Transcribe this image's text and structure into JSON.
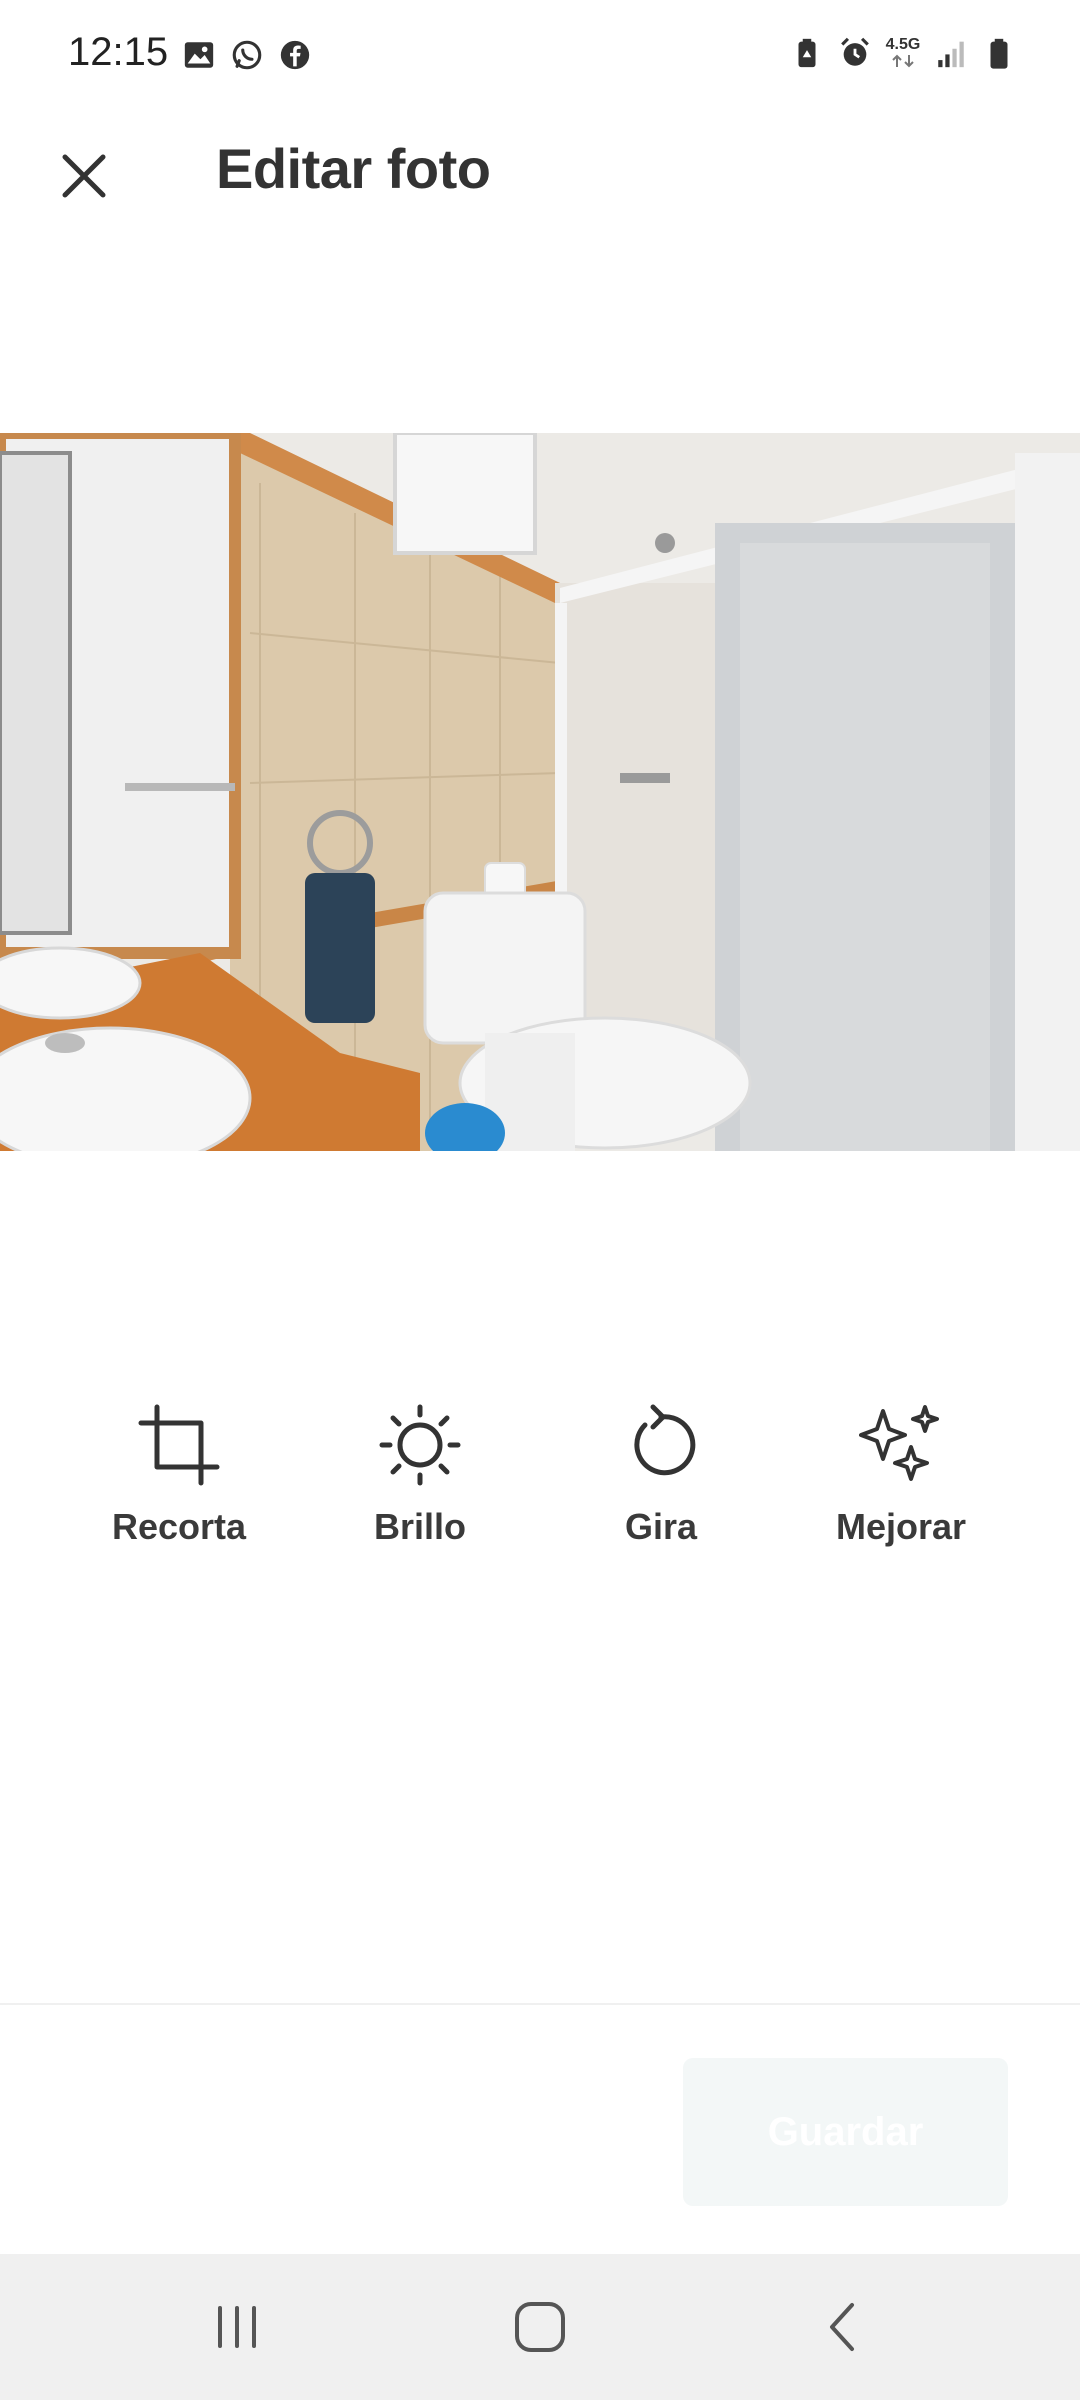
{
  "status_bar": {
    "time": "12:15",
    "network": "4.5G",
    "left_icons": [
      "gallery-icon",
      "whatsapp-icon",
      "facebook-icon"
    ],
    "right_icons": [
      "battery-saver-icon",
      "alarm-icon",
      "network-4-5g-icon",
      "signal-icon",
      "battery-icon"
    ]
  },
  "header": {
    "title": "Editar foto",
    "close_icon": "close-icon"
  },
  "photo": {
    "subject": "bathroom"
  },
  "tools": [
    {
      "label": "Recorta",
      "icon": "crop-icon"
    },
    {
      "label": "Brillo",
      "icon": "brightness-icon"
    },
    {
      "label": "Gira",
      "icon": "rotate-icon"
    },
    {
      "label": "Mejorar",
      "icon": "sparkles-icon"
    }
  ],
  "footer": {
    "save_label": "Guardar",
    "save_disabled": true
  },
  "nav": {
    "items": [
      "recent-apps-icon",
      "home-icon",
      "back-icon"
    ]
  },
  "colors": {
    "text": "#333333",
    "save_bg_disabled": "#f3f7f7",
    "nav_bg": "#f0f0f0"
  }
}
